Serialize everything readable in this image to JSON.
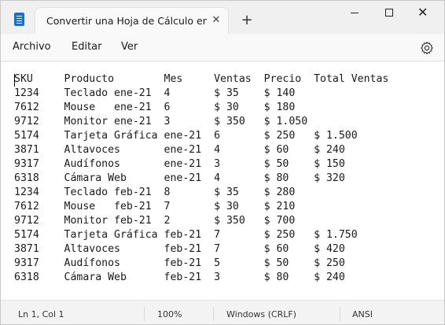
{
  "window": {
    "tab_title": "Convertir una Hoja de Cálculo en u",
    "tab_close_glyph": "✕",
    "new_tab_glyph": "+",
    "close_glyph": "✕"
  },
  "menu": {
    "items": [
      "Archivo",
      "Editar",
      "Ver"
    ]
  },
  "icons": {
    "app": "notepad-icon",
    "settings": "gear-icon"
  },
  "editor": {
    "lines": [
      "SKU     Producto        Mes     Ventas  Precio  Total Ventas",
      "1234    Teclado ene-21  4       $ 35    $ 140",
      "7612    Mouse   ene-21  6       $ 30    $ 180",
      "9712    Monitor ene-21  3       $ 350   $ 1.050",
      "5174    Tarjeta Gráfica ene-21  6       $ 250   $ 1.500",
      "3871    Altavoces       ene-21  4       $ 60    $ 240",
      "9317    Audífonos       ene-21  3       $ 50    $ 150",
      "6318    Cámara Web      ene-21  4       $ 80    $ 320",
      "1234    Teclado feb-21  8       $ 35    $ 280",
      "7612    Mouse   feb-21  7       $ 30    $ 210",
      "9712    Monitor feb-21  2       $ 350   $ 700",
      "5174    Tarjeta Gráfica feb-21  7       $ 250   $ 1.750",
      "3871    Altavoces       feb-21  7       $ 60    $ 420",
      "9317    Audífonos       feb-21  5       $ 50    $ 250",
      "6318    Cámara Web      feb-21  3       $ 80    $ 240"
    ]
  },
  "status": {
    "position": "Ln 1, Col 1",
    "zoom": "100%",
    "line_ending": "Windows (CRLF)",
    "encoding": "ANSI"
  }
}
